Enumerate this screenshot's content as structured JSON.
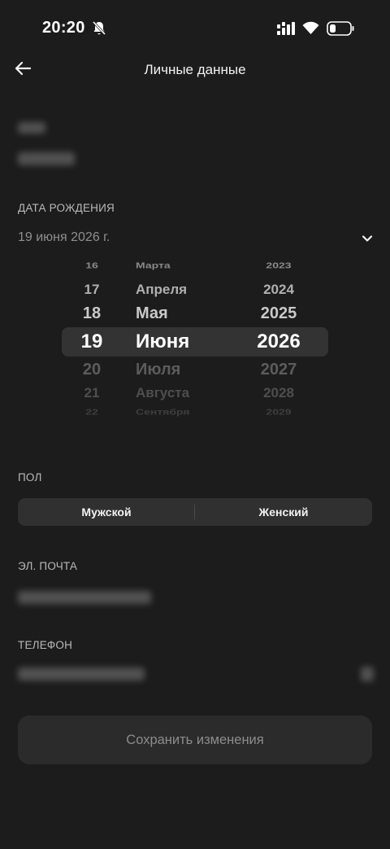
{
  "status_bar": {
    "time": "20:20"
  },
  "header": {
    "title": "Личные данные",
    "back_icon": "arrow-left-icon"
  },
  "birth_date": {
    "label": "ДАТА РОЖДЕНИЯ",
    "value": "19 июня 2026 г.",
    "picker": {
      "rows": [
        {
          "day": "16",
          "month": "Марта",
          "year": "2023"
        },
        {
          "day": "17",
          "month": "Апреля",
          "year": "2024"
        },
        {
          "day": "18",
          "month": "Мая",
          "year": "2025"
        },
        {
          "day": "19",
          "month": "Июня",
          "year": "2026"
        },
        {
          "day": "20",
          "month": "Июля",
          "year": "2027"
        },
        {
          "day": "21",
          "month": "Августа",
          "year": "2028"
        },
        {
          "day": "22",
          "month": "Сентября",
          "year": "2029"
        }
      ],
      "selected": {
        "day": "19",
        "month": "Июня",
        "year": "2026"
      }
    }
  },
  "gender": {
    "label": "ПОЛ",
    "options": [
      "Мужской",
      "Женский"
    ]
  },
  "email": {
    "label": "ЭЛ. ПОЧТА"
  },
  "phone": {
    "label": "ТЕЛЕФОН"
  },
  "actions": {
    "save_label": "Сохранить изменения"
  }
}
